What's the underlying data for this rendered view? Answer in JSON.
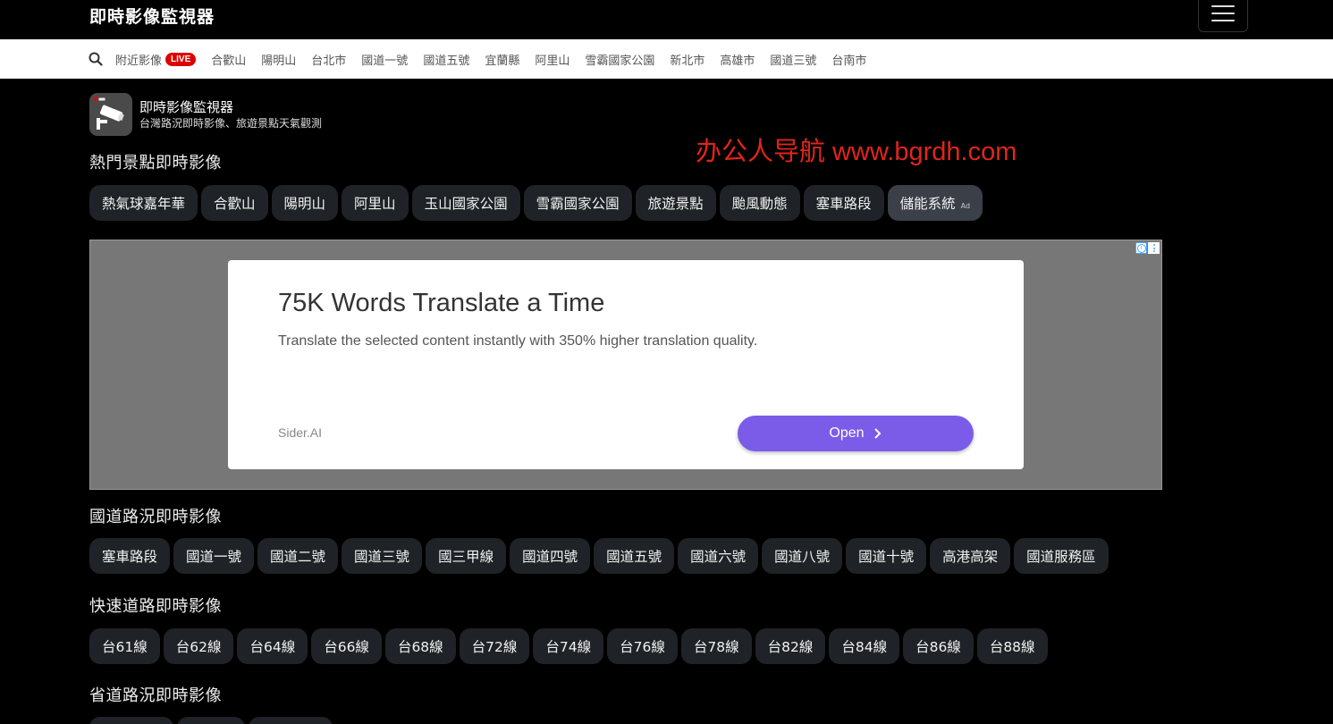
{
  "header": {
    "brand": "即時影像監視器",
    "menu_icon": "hamburger-menu-icon"
  },
  "nav": {
    "search_icon": "search-icon",
    "items": [
      "附近影像",
      "合歡山",
      "陽明山",
      "台北市",
      "國道一號",
      "國道五號",
      "宜蘭縣",
      "阿里山",
      "雪霸國家公園",
      "新北市",
      "高雄市",
      "國道三號",
      "台南市"
    ],
    "live_badge": "LIVE"
  },
  "site": {
    "title": "即時影像監視器",
    "subtitle": "台灣路況即時影像、旅遊景點天氣觀測",
    "icon": "security-camera-icon"
  },
  "watermark": "办公人导航 www.bgrdh.com",
  "sections": {
    "hot": {
      "title": "熱門景點即時影像",
      "chips": [
        "熱氣球嘉年華",
        "合歡山",
        "陽明山",
        "阿里山",
        "玉山國家公園",
        "雪霸國家公園",
        "旅遊景點",
        "颱風動態",
        "塞車路段"
      ],
      "ad_chip": "儲能系統",
      "ad_tag": "Ad"
    },
    "freeway": {
      "title": "國道路況即時影像",
      "chips": [
        "塞車路段",
        "國道一號",
        "國道二號",
        "國道三號",
        "國三甲線",
        "國道四號",
        "國道五號",
        "國道六號",
        "國道八號",
        "國道十號",
        "高港高架",
        "國道服務區"
      ]
    },
    "expressway": {
      "title": "快速道路即時影像",
      "chips": [
        "台61線",
        "台62線",
        "台64線",
        "台66線",
        "台68線",
        "台72線",
        "台74線",
        "台76線",
        "台78線",
        "台82線",
        "台84線",
        "台86線",
        "台88線"
      ]
    },
    "provincial": {
      "title": "省道路況即時影像"
    }
  },
  "ad": {
    "headline": "75K Words Translate a Time",
    "description": "Translate the selected content instantly with 350% higher translation quality.",
    "source": "Sider.AI",
    "button": "Open",
    "button_color": "#7b5ce8"
  },
  "colors": {
    "background": "#000000",
    "chip": "#1f2226",
    "live": "#dd0000",
    "watermark": "#e1251b"
  }
}
